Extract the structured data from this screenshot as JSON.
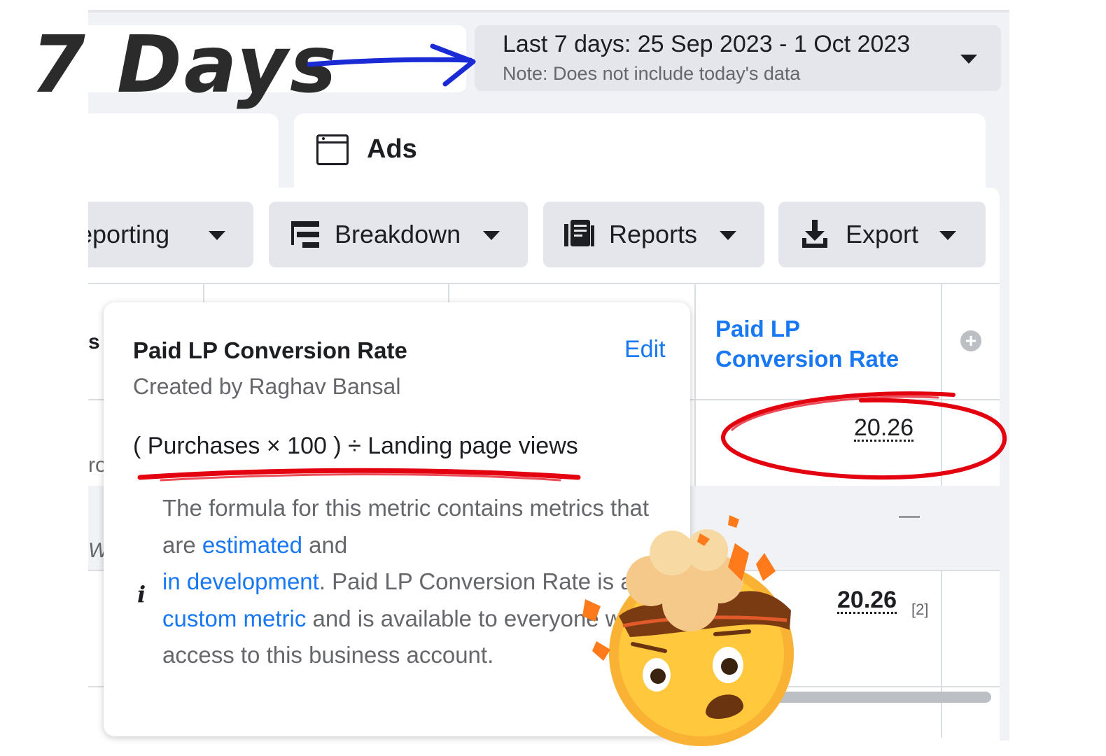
{
  "annotation": {
    "label": "7 Days"
  },
  "date_range": {
    "main": "Last 7 days: 25 Sep 2023 - 1 Oct 2023",
    "note": "Note: Does not include today's data"
  },
  "tabs": {
    "ads_label": "Ads"
  },
  "toolbar": {
    "reporting_label": "Reporting",
    "breakdown_label": "Breakdown",
    "reports_label": "Reports",
    "export_label": "Export"
  },
  "table": {
    "column_header": "Paid LP Conversion Rate",
    "add_column_symbol": "+",
    "row1_value": "20.26",
    "row2_value": "—",
    "total_value": "20.26",
    "total_footnote": "[2]",
    "cut_left_texts": [
      "s",
      "ro",
      "W"
    ]
  },
  "tooltip": {
    "title": "Paid LP Conversion Rate",
    "edit_label": "Edit",
    "creator": "Created by Raghav Bansal",
    "formula": "( Purchases × 100 ) ÷ Landing page views",
    "info_symbol": "i",
    "description": {
      "part1": "The formula for this metric contains metrics that are ",
      "link1": "estimated",
      "part2": " and ",
      "link2": "in development",
      "part3": ". Paid LP Conversion Rate is a ",
      "link3": "custom metric",
      "part4": " and is available to everyone with access to this business account."
    }
  },
  "colors": {
    "accent_blue": "#1877f2",
    "annotation_red": "#e3000f",
    "annotation_arrow_blue": "#1a2bd6",
    "button_gray": "#e4e6eb"
  },
  "icons": [
    "breakdown-icon",
    "reports-icon",
    "export-download-icon",
    "caret-down-icon",
    "ads-window-icon",
    "add-column-icon",
    "info-icon",
    "exploding-head-emoji"
  ]
}
